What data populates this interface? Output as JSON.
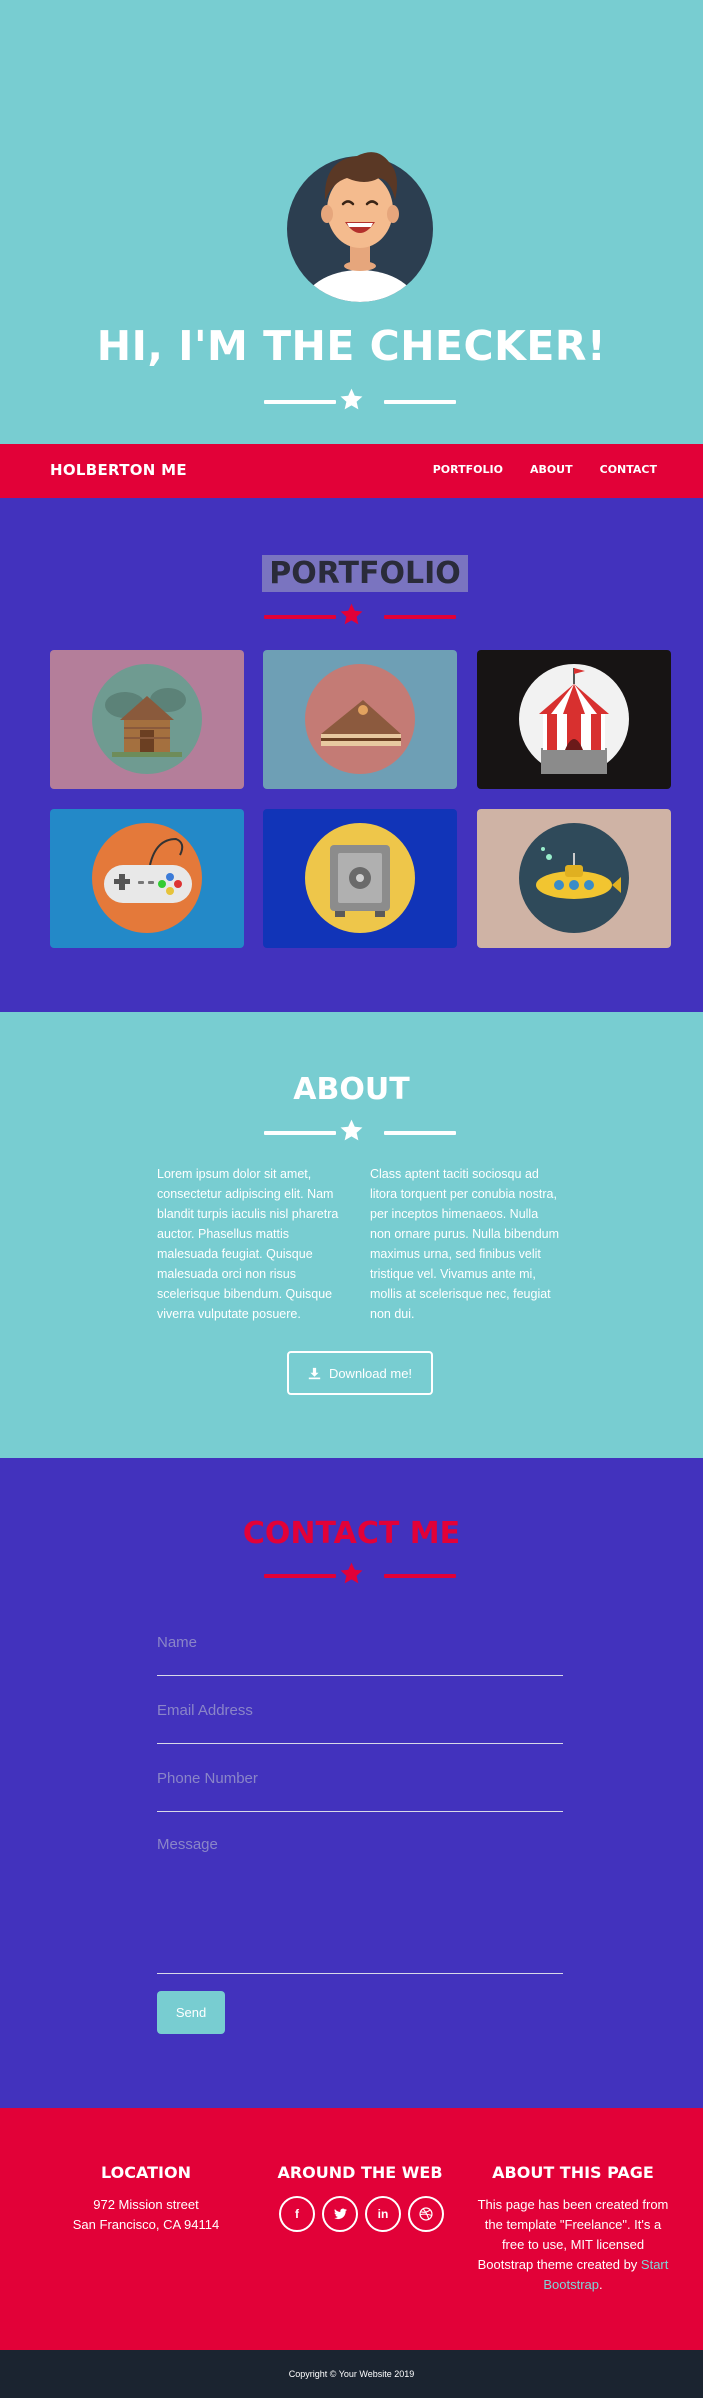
{
  "hero": {
    "title": "HI, I'M THE CHECKER!"
  },
  "nav": {
    "brand": "HOLBERTON ME",
    "links": [
      "PORTFOLIO",
      "ABOUT",
      "CONTACT"
    ]
  },
  "portfolio": {
    "title": "PORTFOLIO",
    "items": [
      {
        "icon": "cabin-icon",
        "bg": "#b47e9a"
      },
      {
        "icon": "cake-icon",
        "bg": "#6e9fb5"
      },
      {
        "icon": "circus-tent-icon",
        "bg": "#171414"
      },
      {
        "icon": "game-controller-icon",
        "bg": "#2389c8"
      },
      {
        "icon": "safe-icon",
        "bg": "#1134b8"
      },
      {
        "icon": "submarine-icon",
        "bg": "#cfb3a5"
      }
    ]
  },
  "about": {
    "title": "ABOUT",
    "col1": "Lorem ipsum dolor sit amet, consectetur adipiscing elit. Nam blandit turpis iaculis nisl pharetra auctor. Phasellus mattis malesuada feugiat. Quisque malesuada orci non risus scelerisque bibendum. Quisque viverra vulputate posuere.",
    "col2": "Class aptent taciti sociosqu ad litora torquent per conubia nostra, per inceptos himenaeos. Nulla non ornare purus. Nulla bibendum maximus urna, sed finibus velit tristique vel. Vivamus ante mi, mollis at scelerisque nec, feugiat non dui.",
    "download_label": "Download me!"
  },
  "contact": {
    "title": "CONTACT ME",
    "name_placeholder": "Name",
    "email_placeholder": "Email Address",
    "phone_placeholder": "Phone Number",
    "message_placeholder": "Message",
    "send_label": "Send"
  },
  "footer": {
    "location_title": "LOCATION",
    "address_line1": "972 Mission street",
    "address_line2": "San Francisco, CA 94114",
    "web_title": "AROUND THE WEB",
    "socials": [
      "f",
      "t",
      "in",
      "dribbble"
    ],
    "about_title": "ABOUT THIS PAGE",
    "about_text": "This page has been created from the template \"Freelance\". It's a free to use, MIT licensed Bootstrap theme created by",
    "about_link": "Start Bootstrap",
    "copyright": "Copyright © Your Website 2019"
  },
  "colors": {
    "teal": "#78cdd1",
    "red": "#e20138",
    "purple": "#4232bd",
    "dark": "#1b2430"
  }
}
